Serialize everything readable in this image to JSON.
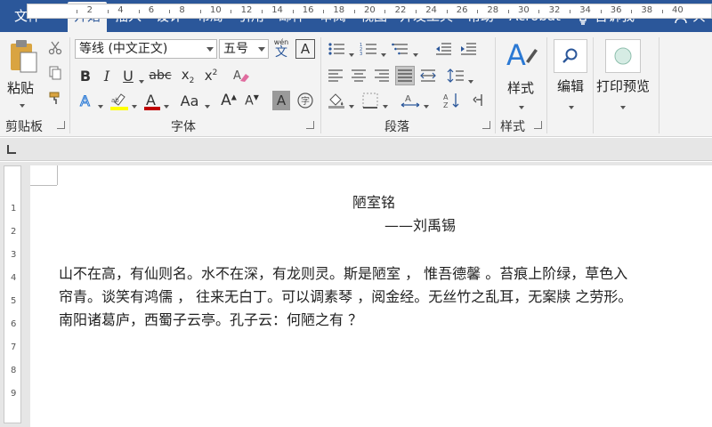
{
  "tabs": [
    "文件",
    "开始",
    "插入",
    "设计",
    "布局",
    "引用",
    "邮件",
    "审阅",
    "视图",
    "开发工具",
    "帮助",
    "Acrobat"
  ],
  "tell_me": "告诉我",
  "share": "共",
  "ribbon": {
    "clipboard": {
      "paste_label": "粘贴",
      "group_label": "剪贴板"
    },
    "font": {
      "font_name": "等线 (中文正文)",
      "font_size": "五号",
      "wen_top": "wén",
      "wen_bottom": "文",
      "group_label": "字体",
      "change_case": "Aa"
    },
    "paragraph": {
      "group_label": "段落"
    },
    "styles": {
      "label": "样式",
      "group_label": "样式"
    },
    "editing": {
      "label": "编辑"
    },
    "print_preview": {
      "label": "打印预览"
    }
  },
  "ruler": {
    "numbers": [
      "2",
      "4",
      "6",
      "8",
      "10",
      "12",
      "14",
      "16",
      "18",
      "20",
      "22",
      "24",
      "26",
      "28",
      "30",
      "32",
      "34",
      "36",
      "38",
      "40"
    ],
    "vnumbers": [
      "1",
      "2",
      "3",
      "4",
      "5",
      "6",
      "7",
      "8",
      "9"
    ]
  },
  "document": {
    "title": "陋室铭",
    "author": "——刘禹锡",
    "lines": [
      "山不在高，有仙则名。水不在深，有龙则灵。斯是陋室 ， 惟吾德馨 。苔痕上阶绿，草色入",
      "帘青。谈笑有鸿儒 ， 往来无白丁。可以调素琴 ，阅金经。无丝竹之乱耳，无案牍 之劳形。",
      "南阳诸葛庐，西蜀子云亭。孔子云：何陋之有 ？"
    ]
  },
  "colors": {
    "accent": "#2b579a",
    "highlight": "#ffff00",
    "font_color": "#c00000"
  }
}
